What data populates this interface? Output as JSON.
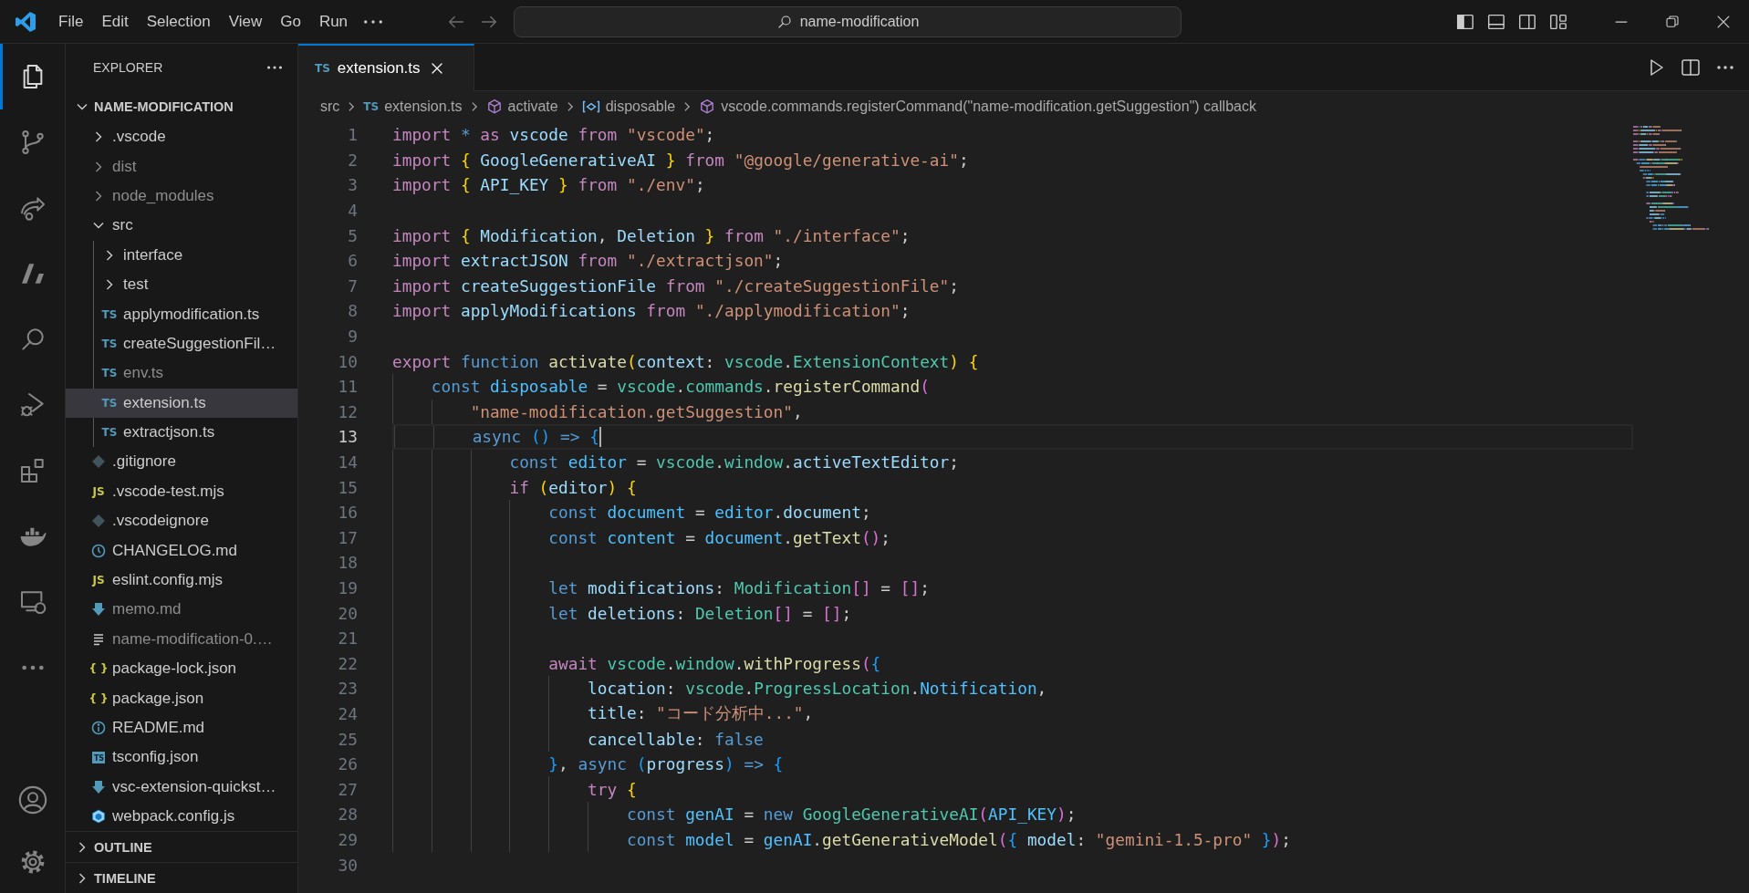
{
  "title_bar": {
    "menu": [
      "File",
      "Edit",
      "Selection",
      "View",
      "Go",
      "Run"
    ],
    "command_center": "name-modification"
  },
  "activity_bar": {
    "items": [
      {
        "kind": "files",
        "selected": true
      },
      {
        "kind": "source-control",
        "selected": false
      },
      {
        "kind": "share",
        "selected": false
      },
      {
        "kind": "slashes",
        "selected": false
      },
      {
        "kind": "search",
        "selected": false
      },
      {
        "kind": "debug",
        "selected": false
      },
      {
        "kind": "extensions",
        "selected": false
      },
      {
        "kind": "docker",
        "selected": false
      },
      {
        "kind": "remote",
        "selected": false
      },
      {
        "kind": "more",
        "selected": false
      }
    ],
    "bottom": [
      {
        "kind": "account"
      },
      {
        "kind": "settings"
      }
    ]
  },
  "explorer": {
    "title": "EXPLORER",
    "root": {
      "label": "NAME-MODIFICATION",
      "expanded": true,
      "children": [
        {
          "label": ".vscode",
          "kind": "folder",
          "expanded": false,
          "ignored": false,
          "selected": false
        },
        {
          "label": "dist",
          "kind": "folder",
          "expanded": false,
          "ignored": true,
          "selected": false
        },
        {
          "label": "node_modules",
          "kind": "folder",
          "expanded": false,
          "ignored": true,
          "selected": false
        },
        {
          "label": "src",
          "kind": "folder",
          "expanded": true,
          "ignored": false,
          "selected": false,
          "children": [
            {
              "label": "interface",
              "kind": "folder",
              "expanded": false,
              "ignored": false,
              "selected": false
            },
            {
              "label": "test",
              "kind": "folder",
              "expanded": false,
              "ignored": false,
              "selected": false
            },
            {
              "label": "applymodification.ts",
              "kind": "ts",
              "badge": "TS",
              "ignored": false,
              "selected": false
            },
            {
              "label": "createSuggestionFil…",
              "kind": "ts",
              "badge": "TS",
              "ignored": false,
              "selected": false
            },
            {
              "label": "env.ts",
              "kind": "ts",
              "badge": "TS",
              "ignored": true,
              "selected": false
            },
            {
              "label": "extension.ts",
              "kind": "ts",
              "badge": "TS",
              "ignored": false,
              "selected": true
            },
            {
              "label": "extractjson.ts",
              "kind": "ts",
              "badge": "TS",
              "ignored": false,
              "selected": false
            }
          ]
        },
        {
          "label": ".gitignore",
          "kind": "git",
          "ignored": false,
          "selected": false
        },
        {
          "label": ".vscode-test.mjs",
          "kind": "js",
          "badge": "JS",
          "ignored": false,
          "selected": false
        },
        {
          "label": ".vscodeignore",
          "kind": "git",
          "ignored": false,
          "selected": false
        },
        {
          "label": "CHANGELOG.md",
          "kind": "changelog",
          "ignored": false,
          "selected": false
        },
        {
          "label": "eslint.config.mjs",
          "kind": "js",
          "badge": "JS",
          "ignored": false,
          "selected": false
        },
        {
          "label": "memo.md",
          "kind": "markdown",
          "ignored": true,
          "selected": false
        },
        {
          "label": "name-modification-0.…",
          "kind": "text",
          "ignored": true,
          "selected": false
        },
        {
          "label": "package-lock.json",
          "kind": "json",
          "badge": "{ }",
          "ignored": false,
          "selected": false
        },
        {
          "label": "package.json",
          "kind": "json",
          "badge": "{ }",
          "ignored": false,
          "selected": false
        },
        {
          "label": "README.md",
          "kind": "readme",
          "ignored": false,
          "selected": false
        },
        {
          "label": "tsconfig.json",
          "kind": "tsconfig",
          "badge": "TS",
          "ignored": false,
          "selected": false
        },
        {
          "label": "vsc-extension-quickst…",
          "kind": "markdown",
          "ignored": false,
          "selected": false
        },
        {
          "label": "webpack.config.js",
          "kind": "webpack",
          "ignored": false,
          "selected": false
        }
      ]
    },
    "sections": [
      {
        "label": "OUTLINE",
        "expanded": false
      },
      {
        "label": "TIMELINE",
        "expanded": false
      }
    ]
  },
  "tabs": [
    {
      "label": "extension.ts",
      "badge": "TS",
      "selected": true
    }
  ],
  "breadcrumbs": [
    {
      "kind": "folder",
      "label": "src"
    },
    {
      "kind": "ts",
      "badge": "TS",
      "label": "extension.ts"
    },
    {
      "kind": "function",
      "label": "activate"
    },
    {
      "kind": "variable",
      "label": "disposable"
    },
    {
      "kind": "function",
      "label": "vscode.commands.registerCommand(\"name-modification.getSuggestion\") callback"
    }
  ],
  "editor": {
    "lines": [
      {
        "number": "1",
        "current": false,
        "tokens": [
          {
            "kind": "kw",
            "text": "import "
          },
          {
            "kind": "st",
            "text": "* "
          },
          {
            "kind": "kw",
            "text": "as "
          },
          {
            "kind": "var",
            "text": "vscode "
          },
          {
            "kind": "kw",
            "text": "from "
          },
          {
            "kind": "str",
            "text": "\"vscode\""
          },
          {
            "kind": "p",
            "text": ";"
          }
        ]
      },
      {
        "number": "2",
        "current": false,
        "tokens": [
          {
            "kind": "kw",
            "text": "import "
          },
          {
            "kind": "b1",
            "text": "{ "
          },
          {
            "kind": "var",
            "text": "GoogleGenerativeAI "
          },
          {
            "kind": "b1",
            "text": "} "
          },
          {
            "kind": "kw",
            "text": "from "
          },
          {
            "kind": "str",
            "text": "\"@google/generative-ai\""
          },
          {
            "kind": "p",
            "text": ";"
          }
        ]
      },
      {
        "number": "3",
        "current": false,
        "tokens": [
          {
            "kind": "kw",
            "text": "import "
          },
          {
            "kind": "b1",
            "text": "{ "
          },
          {
            "kind": "var",
            "text": "API_KEY "
          },
          {
            "kind": "b1",
            "text": "} "
          },
          {
            "kind": "kw",
            "text": "from "
          },
          {
            "kind": "str",
            "text": "\"./env\""
          },
          {
            "kind": "p",
            "text": ";"
          }
        ]
      },
      {
        "number": "4",
        "current": false
      },
      {
        "number": "5",
        "current": false,
        "tokens": [
          {
            "kind": "kw",
            "text": "import "
          },
          {
            "kind": "b1",
            "text": "{ "
          },
          {
            "kind": "var",
            "text": "Modification"
          },
          {
            "kind": "p",
            "text": ", "
          },
          {
            "kind": "var",
            "text": "Deletion "
          },
          {
            "kind": "b1",
            "text": "} "
          },
          {
            "kind": "kw",
            "text": "from "
          },
          {
            "kind": "str",
            "text": "\"./interface\""
          },
          {
            "kind": "p",
            "text": ";"
          }
        ]
      },
      {
        "number": "6",
        "current": false,
        "tokens": [
          {
            "kind": "kw",
            "text": "import "
          },
          {
            "kind": "var",
            "text": "extractJSON "
          },
          {
            "kind": "kw",
            "text": "from "
          },
          {
            "kind": "str",
            "text": "\"./extractjson\""
          },
          {
            "kind": "p",
            "text": ";"
          }
        ]
      },
      {
        "number": "7",
        "current": false,
        "tokens": [
          {
            "kind": "kw",
            "text": "import "
          },
          {
            "kind": "var",
            "text": "createSuggestionFile "
          },
          {
            "kind": "kw",
            "text": "from "
          },
          {
            "kind": "str",
            "text": "\"./createSuggestionFile\""
          },
          {
            "kind": "p",
            "text": ";"
          }
        ]
      },
      {
        "number": "8",
        "current": false,
        "tokens": [
          {
            "kind": "kw",
            "text": "import "
          },
          {
            "kind": "var",
            "text": "applyModifications "
          },
          {
            "kind": "kw",
            "text": "from "
          },
          {
            "kind": "str",
            "text": "\"./applymodification\""
          },
          {
            "kind": "p",
            "text": ";"
          }
        ]
      },
      {
        "number": "9",
        "current": false
      },
      {
        "number": "10",
        "current": false,
        "tokens": [
          {
            "kind": "kw",
            "text": "export "
          },
          {
            "kind": "st",
            "text": "function "
          },
          {
            "kind": "fn",
            "text": "activate"
          },
          {
            "kind": "b1",
            "text": "("
          },
          {
            "kind": "var",
            "text": "context"
          },
          {
            "kind": "p",
            "text": ": "
          },
          {
            "kind": "type",
            "text": "vscode"
          },
          {
            "kind": "p",
            "text": "."
          },
          {
            "kind": "type",
            "text": "ExtensionContext"
          },
          {
            "kind": "b1",
            "text": ") "
          },
          {
            "kind": "b1",
            "text": "{"
          }
        ]
      },
      {
        "number": "11",
        "current": false,
        "tokens": [
          {
            "kind": "st",
            "text": "    const "
          },
          {
            "kind": "const",
            "text": "disposable "
          },
          {
            "kind": "p",
            "text": "= "
          },
          {
            "kind": "type",
            "text": "vscode"
          },
          {
            "kind": "p",
            "text": "."
          },
          {
            "kind": "type",
            "text": "commands"
          },
          {
            "kind": "p",
            "text": "."
          },
          {
            "kind": "fn",
            "text": "registerCommand"
          },
          {
            "kind": "b2",
            "text": "("
          }
        ]
      },
      {
        "number": "12",
        "current": false,
        "tokens": [
          {
            "kind": "str",
            "text": "        \"name-modification.getSuggestion\""
          },
          {
            "kind": "p",
            "text": ","
          }
        ]
      },
      {
        "number": "13",
        "current": true,
        "tokens": [
          {
            "kind": "st",
            "text": "        async "
          },
          {
            "kind": "b3",
            "text": "() "
          },
          {
            "kind": "st",
            "text": "=> "
          },
          {
            "kind": "b3",
            "text": "{"
          }
        ]
      },
      {
        "number": "14",
        "current": false,
        "tokens": [
          {
            "kind": "st",
            "text": "            const "
          },
          {
            "kind": "const",
            "text": "editor "
          },
          {
            "kind": "p",
            "text": "= "
          },
          {
            "kind": "type",
            "text": "vscode"
          },
          {
            "kind": "p",
            "text": "."
          },
          {
            "kind": "type",
            "text": "window"
          },
          {
            "kind": "p",
            "text": "."
          },
          {
            "kind": "var",
            "text": "activeTextEditor"
          },
          {
            "kind": "p",
            "text": ";"
          }
        ]
      },
      {
        "number": "15",
        "current": false,
        "tokens": [
          {
            "kind": "kw",
            "text": "            if "
          },
          {
            "kind": "b1",
            "text": "("
          },
          {
            "kind": "var",
            "text": "editor"
          },
          {
            "kind": "b1",
            "text": ") "
          },
          {
            "kind": "b1",
            "text": "{"
          }
        ]
      },
      {
        "number": "16",
        "current": false,
        "tokens": [
          {
            "kind": "st",
            "text": "                const "
          },
          {
            "kind": "const",
            "text": "document "
          },
          {
            "kind": "p",
            "text": "= "
          },
          {
            "kind": "const",
            "text": "editor"
          },
          {
            "kind": "p",
            "text": "."
          },
          {
            "kind": "var",
            "text": "document"
          },
          {
            "kind": "p",
            "text": ";"
          }
        ]
      },
      {
        "number": "17",
        "current": false,
        "tokens": [
          {
            "kind": "st",
            "text": "                const "
          },
          {
            "kind": "const",
            "text": "content "
          },
          {
            "kind": "p",
            "text": "= "
          },
          {
            "kind": "const",
            "text": "document"
          },
          {
            "kind": "p",
            "text": "."
          },
          {
            "kind": "fn",
            "text": "getText"
          },
          {
            "kind": "b2",
            "text": "()"
          },
          {
            "kind": "p",
            "text": ";"
          }
        ]
      },
      {
        "number": "18",
        "current": false
      },
      {
        "number": "19",
        "current": false,
        "tokens": [
          {
            "kind": "st",
            "text": "                let "
          },
          {
            "kind": "var",
            "text": "modifications"
          },
          {
            "kind": "p",
            "text": ": "
          },
          {
            "kind": "type",
            "text": "Modification"
          },
          {
            "kind": "b2",
            "text": "[]"
          },
          {
            "kind": "p",
            "text": " = "
          },
          {
            "kind": "b2",
            "text": "[]"
          },
          {
            "kind": "p",
            "text": ";"
          }
        ]
      },
      {
        "number": "20",
        "current": false,
        "tokens": [
          {
            "kind": "st",
            "text": "                let "
          },
          {
            "kind": "var",
            "text": "deletions"
          },
          {
            "kind": "p",
            "text": ": "
          },
          {
            "kind": "type",
            "text": "Deletion"
          },
          {
            "kind": "b2",
            "text": "[]"
          },
          {
            "kind": "p",
            "text": " = "
          },
          {
            "kind": "b2",
            "text": "[]"
          },
          {
            "kind": "p",
            "text": ";"
          }
        ]
      },
      {
        "number": "21",
        "current": false
      },
      {
        "number": "22",
        "current": false,
        "tokens": [
          {
            "kind": "kw",
            "text": "                await "
          },
          {
            "kind": "type",
            "text": "vscode"
          },
          {
            "kind": "p",
            "text": "."
          },
          {
            "kind": "type",
            "text": "window"
          },
          {
            "kind": "p",
            "text": "."
          },
          {
            "kind": "fn",
            "text": "withProgress"
          },
          {
            "kind": "b2",
            "text": "("
          },
          {
            "kind": "b3",
            "text": "{"
          }
        ]
      },
      {
        "number": "23",
        "current": false,
        "tokens": [
          {
            "kind": "var",
            "text": "                    location"
          },
          {
            "kind": "p",
            "text": ": "
          },
          {
            "kind": "type",
            "text": "vscode"
          },
          {
            "kind": "p",
            "text": "."
          },
          {
            "kind": "type",
            "text": "ProgressLocation"
          },
          {
            "kind": "p",
            "text": "."
          },
          {
            "kind": "const",
            "text": "Notification"
          },
          {
            "kind": "p",
            "text": ","
          }
        ]
      },
      {
        "number": "24",
        "current": false,
        "tokens": [
          {
            "kind": "var",
            "text": "                    title"
          },
          {
            "kind": "p",
            "text": ": "
          },
          {
            "kind": "str",
            "text": "\"コード分析中...\""
          },
          {
            "kind": "p",
            "text": ","
          }
        ]
      },
      {
        "number": "25",
        "current": false,
        "tokens": [
          {
            "kind": "var",
            "text": "                    cancellable"
          },
          {
            "kind": "p",
            "text": ": "
          },
          {
            "kind": "st",
            "text": "false"
          }
        ]
      },
      {
        "number": "26",
        "current": false,
        "tokens": [
          {
            "kind": "b3",
            "text": "                }"
          },
          {
            "kind": "p",
            "text": ", "
          },
          {
            "kind": "st",
            "text": "async "
          },
          {
            "kind": "b3",
            "text": "("
          },
          {
            "kind": "var",
            "text": "progress"
          },
          {
            "kind": "b3",
            "text": ") "
          },
          {
            "kind": "st",
            "text": "=> "
          },
          {
            "kind": "b3",
            "text": "{"
          }
        ]
      },
      {
        "number": "27",
        "current": false,
        "tokens": [
          {
            "kind": "kw",
            "text": "                    try "
          },
          {
            "kind": "b1",
            "text": "{"
          }
        ]
      },
      {
        "number": "28",
        "current": false,
        "tokens": [
          {
            "kind": "st",
            "text": "                        const "
          },
          {
            "kind": "const",
            "text": "genAI "
          },
          {
            "kind": "p",
            "text": "= "
          },
          {
            "kind": "st",
            "text": "new "
          },
          {
            "kind": "type",
            "text": "GoogleGenerativeAI"
          },
          {
            "kind": "b2",
            "text": "("
          },
          {
            "kind": "const",
            "text": "API_KEY"
          },
          {
            "kind": "b2",
            "text": ")"
          },
          {
            "kind": "p",
            "text": ";"
          }
        ]
      },
      {
        "number": "29",
        "current": false,
        "tokens": [
          {
            "kind": "st",
            "text": "                        const "
          },
          {
            "kind": "const",
            "text": "model "
          },
          {
            "kind": "p",
            "text": "= "
          },
          {
            "kind": "const",
            "text": "genAI"
          },
          {
            "kind": "p",
            "text": "."
          },
          {
            "kind": "fn",
            "text": "getGenerativeModel"
          },
          {
            "kind": "b2",
            "text": "("
          },
          {
            "kind": "b3",
            "text": "{ "
          },
          {
            "kind": "var",
            "text": "model"
          },
          {
            "kind": "p",
            "text": ": "
          },
          {
            "kind": "str",
            "text": "\"gemini-1.5-pro\" "
          },
          {
            "kind": "b3",
            "text": "}"
          },
          {
            "kind": "b2",
            "text": ")"
          },
          {
            "kind": "p",
            "text": ";"
          }
        ]
      },
      {
        "number": "30",
        "current": false
      }
    ]
  }
}
